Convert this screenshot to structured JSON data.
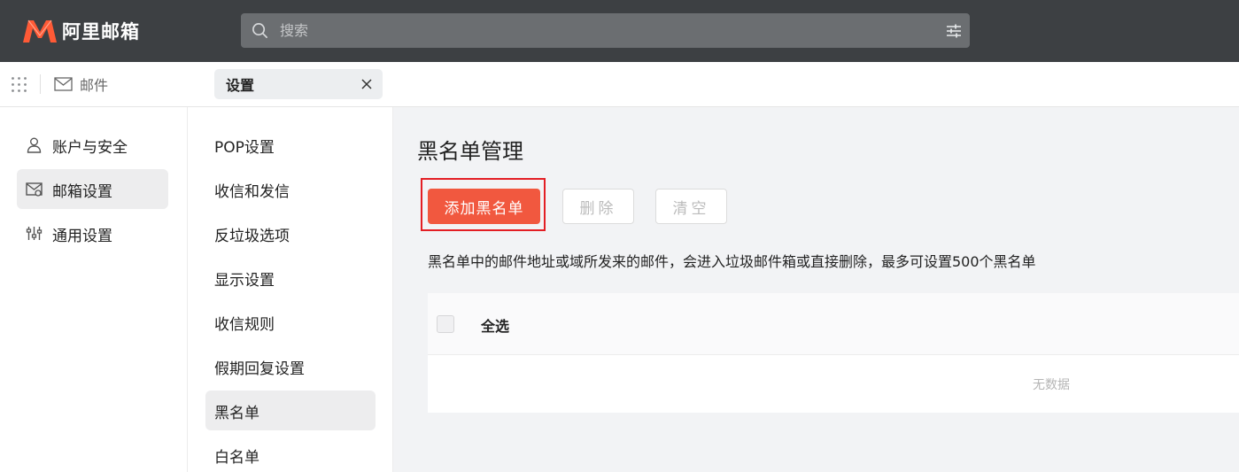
{
  "header": {
    "logo_text": "阿里邮箱",
    "search_placeholder": "搜索",
    "brand_color": "#ff5a36"
  },
  "subbar": {
    "mail_label": "邮件",
    "tab_label": "设置"
  },
  "sidebar": {
    "items": [
      {
        "label": "账户与安全",
        "icon": "user-icon"
      },
      {
        "label": "邮箱设置",
        "icon": "mailbox-settings-icon",
        "active": true
      },
      {
        "label": "通用设置",
        "icon": "sliders-icon"
      }
    ]
  },
  "submenu": {
    "items": [
      {
        "label": "POP设置"
      },
      {
        "label": "收信和发信"
      },
      {
        "label": "反垃圾选项"
      },
      {
        "label": "显示设置"
      },
      {
        "label": "收信规则"
      },
      {
        "label": "假期回复设置"
      },
      {
        "label": "黑名单",
        "active": true
      },
      {
        "label": "白名单"
      }
    ]
  },
  "main": {
    "title": "黑名单管理",
    "add_button": "添加黑名单",
    "delete_button": "删除",
    "clear_button": "清空",
    "info": "黑名单中的邮件地址或域所发来的邮件，会进入垃圾邮件箱或直接删除，最多可设置500个黑名单",
    "table": {
      "select_all": "全选",
      "empty_text": "无数据"
    },
    "accent_color": "#f1583f"
  }
}
